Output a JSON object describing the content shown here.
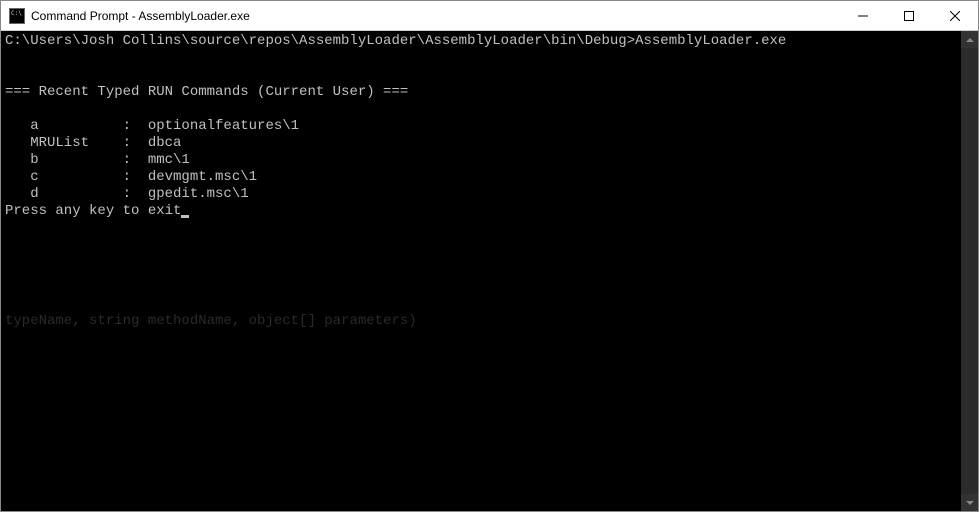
{
  "window": {
    "title": "Command Prompt - AssemblyLoader.exe"
  },
  "console": {
    "prompt": "C:\\Users\\Josh Collins\\source\\repos\\AssemblyLoader\\AssemblyLoader\\bin\\Debug>AssemblyLoader.exe",
    "blank1": "",
    "blank2": "",
    "header": "=== Recent Typed RUN Commands (Current User) ===",
    "blank3": "",
    "row_a": "   a          :  optionalfeatures\\1",
    "row_mru": "   MRUList    :  dbca",
    "row_b": "   b          :  mmc\\1",
    "row_c": "   c          :  devmgmt.msc\\1",
    "row_d": "   d          :  gpedit.msc\\1",
    "exit": "Press any key to exit"
  },
  "ghost": {
    "text": "typeName, string methodName, object[] parameters)"
  }
}
